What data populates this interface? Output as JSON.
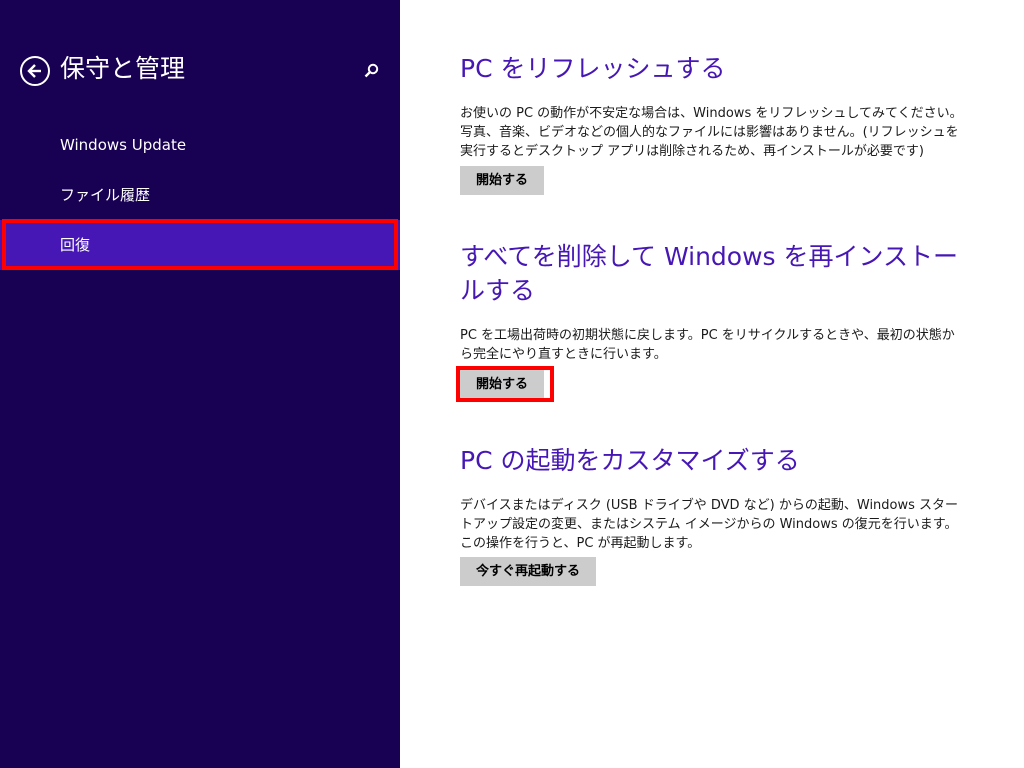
{
  "colors": {
    "nav_background": "#180052",
    "nav_selected": "#4617b4",
    "accent_title": "#4617b4",
    "button_background": "#cccccc",
    "highlight_border": "#ff0000"
  },
  "nav": {
    "back_icon": "back-arrow-circle-icon",
    "title": "保守と管理",
    "search_icon": "search-icon",
    "items": [
      {
        "label": "Windows Update",
        "selected": false
      },
      {
        "label": "ファイル履歴",
        "selected": false
      },
      {
        "label": "回復",
        "selected": true
      }
    ]
  },
  "sections": [
    {
      "title": "PC をリフレッシュする",
      "description": "お使いの PC の動作が不安定な場合は、Windows をリフレッシュしてみてください。写真、音楽、ビデオなどの個人的なファイルには影響はありません。(リフレッシュを実行するとデスクトップ アプリは削除されるため、再インストールが必要です)",
      "button": "開始する"
    },
    {
      "title": "すべてを削除して Windows を再インストールする",
      "description": "PC を工場出荷時の初期状態に戻します。PC をリサイクルするときや、最初の状態から完全にやり直すときに行います。",
      "button": "開始する"
    },
    {
      "title": "PC の起動をカスタマイズする",
      "description": "デバイスまたはディスク (USB ドライブや DVD など) からの起動、Windows スタートアップ設定の変更、またはシステム イメージからの Windows の復元を行います。この操作を行うと、PC が再起動します。",
      "button": "今すぐ再起動する"
    }
  ]
}
